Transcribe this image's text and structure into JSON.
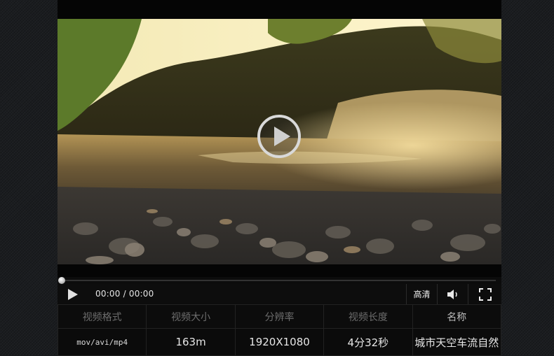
{
  "player": {
    "play_icon": "play-circle-icon",
    "progress_fraction": 0.0,
    "time_display": "00:00 / 00:00",
    "hd_label": "高清",
    "volume_icon": "volume-icon",
    "fullscreen_icon": "fullscreen-icon"
  },
  "info": {
    "headers": [
      "视频格式",
      "视频大小",
      "分辨率",
      "视频长度",
      "名称"
    ],
    "values": [
      "mov/avi/mp4",
      "163m",
      "1920X1080",
      "4分32秒",
      "城市天空车流自然"
    ]
  },
  "colors": {
    "background": "#1b1d20",
    "player_bg": "#000000",
    "header_text": "#6d6d6d",
    "value_text": "#e6e6e6"
  }
}
